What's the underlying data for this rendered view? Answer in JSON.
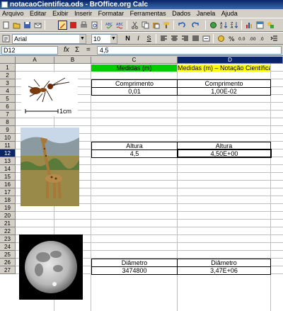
{
  "window": {
    "title": "notacaoCientifica.ods - BrOffice.org Calc"
  },
  "menu": [
    "Arquivo",
    "Editar",
    "Exibir",
    "Inserir",
    "Formatar",
    "Ferramentas",
    "Dados",
    "Janela",
    "Ajuda"
  ],
  "format_bar": {
    "font_name": "Arial",
    "font_size": "10",
    "bold": "N",
    "italic": "I",
    "underline": "S"
  },
  "formula_bar": {
    "name_box": "D12",
    "fx_icon": "fx",
    "sum_icon": "Σ",
    "equals_icon": "=",
    "content": "4,5"
  },
  "columns": [
    "A",
    "B",
    "C",
    "D"
  ],
  "selected_column": "D",
  "rows": [
    "1",
    "2",
    "3",
    "4",
    "5",
    "6",
    "7",
    "8",
    "9",
    "10",
    "11",
    "12",
    "13",
    "14",
    "15",
    "16",
    "17",
    "18",
    "19",
    "20",
    "21",
    "22",
    "23",
    "24",
    "25",
    "26",
    "27"
  ],
  "selected_row": "12",
  "cells": {
    "c1": "Medidas (m)",
    "d1": "Medidas (m) – Notação Científica",
    "c3": "Comprimento",
    "d3": "Comprimento",
    "c4": "0,01",
    "d4": "1,00E-02",
    "c11": "Altura",
    "d11": "Altura",
    "c12": "4,5",
    "d12": "4,50E+00",
    "c25": "Diâmetro",
    "d25": "Diâmetro",
    "c26": "3474800",
    "d26": "3,47E+06"
  },
  "images": {
    "ant_scale_label": "1cm"
  },
  "colors": {
    "header_green": "#00cc00",
    "header_yellow": "#ffff00",
    "selection": "#0a246a"
  }
}
